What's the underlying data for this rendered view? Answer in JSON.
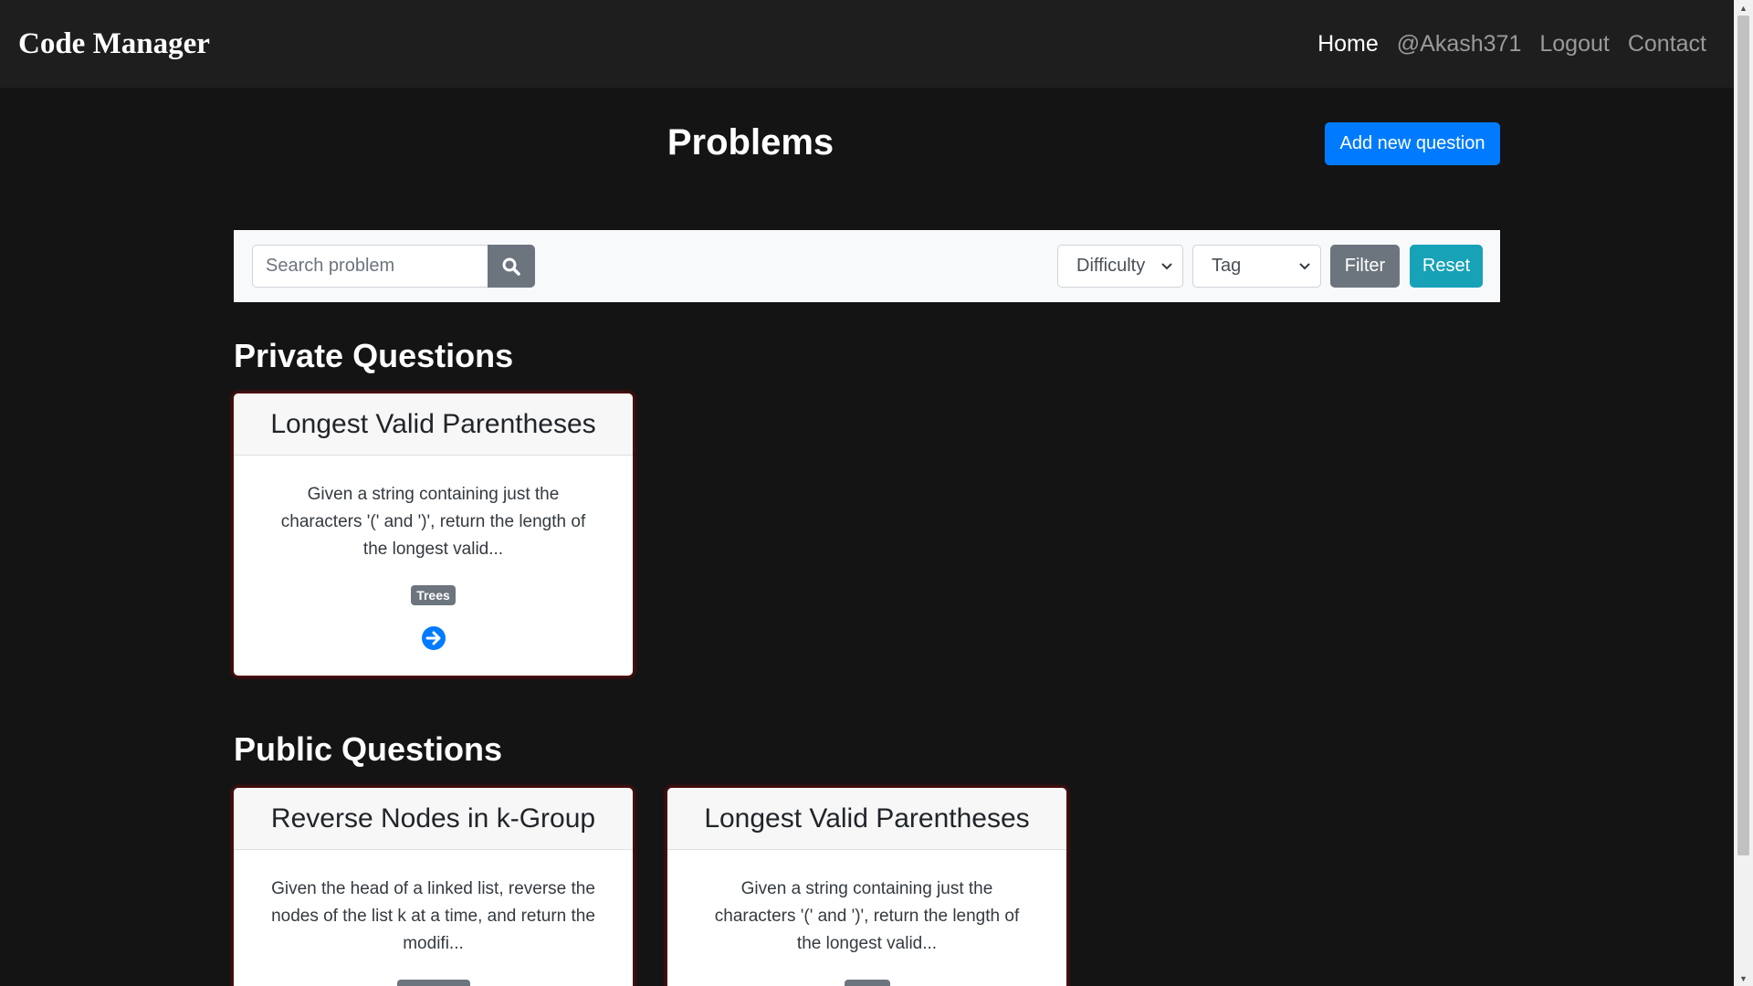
{
  "navbar": {
    "brand": "Code Manager",
    "links": [
      {
        "label": "Home",
        "active": true
      },
      {
        "label": "@Akash371",
        "active": false
      },
      {
        "label": "Logout",
        "active": false
      },
      {
        "label": "Contact",
        "active": false
      }
    ]
  },
  "header": {
    "title": "Problems",
    "add_button": "Add new question"
  },
  "filters": {
    "search_placeholder": "Search problem",
    "search_icon": "search-icon",
    "difficulty_selected": "Difficulty",
    "tag_selected": "Tag",
    "filter_label": "Filter",
    "reset_label": "Reset"
  },
  "private_section": {
    "heading": "Private Questions",
    "cards": [
      {
        "title": "Longest Valid Parentheses",
        "description": "Given a string containing just the characters '(' and ')', return the length of the longest valid...",
        "tag": "Trees"
      }
    ]
  },
  "public_section": {
    "heading": "Public Questions",
    "cards": [
      {
        "title": "Reverse Nodes in k-Group",
        "description": "Given the head of a linked list, reverse the nodes of the list k at a time, and return the modifi...",
        "tag": ""
      },
      {
        "title": "Longest Valid Parentheses",
        "description": "Given a string containing just the characters '(' and ')', return the length of the longest valid...",
        "tag": ""
      }
    ]
  },
  "colors": {
    "primary": "#007bff",
    "secondary": "#6c757d",
    "info": "#17a2b8",
    "background": "#141414",
    "navbar": "#1e1e1e"
  }
}
